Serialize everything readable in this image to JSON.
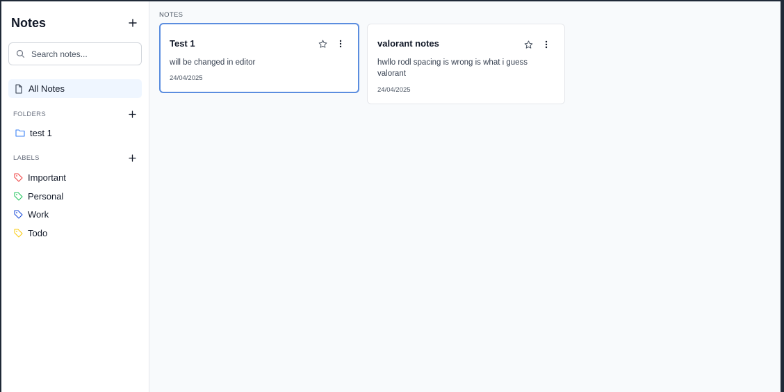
{
  "sidebar": {
    "title": "Notes",
    "search_placeholder": "Search notes...",
    "all_notes_label": "All Notes",
    "folders_heading": "FOLDERS",
    "folders": [
      {
        "name": "test 1"
      }
    ],
    "labels_heading": "LABELS",
    "labels": [
      {
        "name": "Important",
        "color": "#ef4444"
      },
      {
        "name": "Personal",
        "color": "#22c55e"
      },
      {
        "name": "Work",
        "color": "#1d4ed8"
      },
      {
        "name": "Todo",
        "color": "#facc15"
      }
    ]
  },
  "main": {
    "heading": "NOTES",
    "notes": [
      {
        "title": "Test 1",
        "body": "will be changed in editor",
        "date": "24/04/2025",
        "selected": true
      },
      {
        "title": "valorant notes",
        "body": "hwllo rodl spacing is wrong is what i guess valorant",
        "date": "24/04/2025",
        "selected": false
      }
    ]
  },
  "colors": {
    "accent": "#5b8ddf",
    "folder_icon": "#3b82f6",
    "selected_nav_bg": "#eff6ff"
  }
}
